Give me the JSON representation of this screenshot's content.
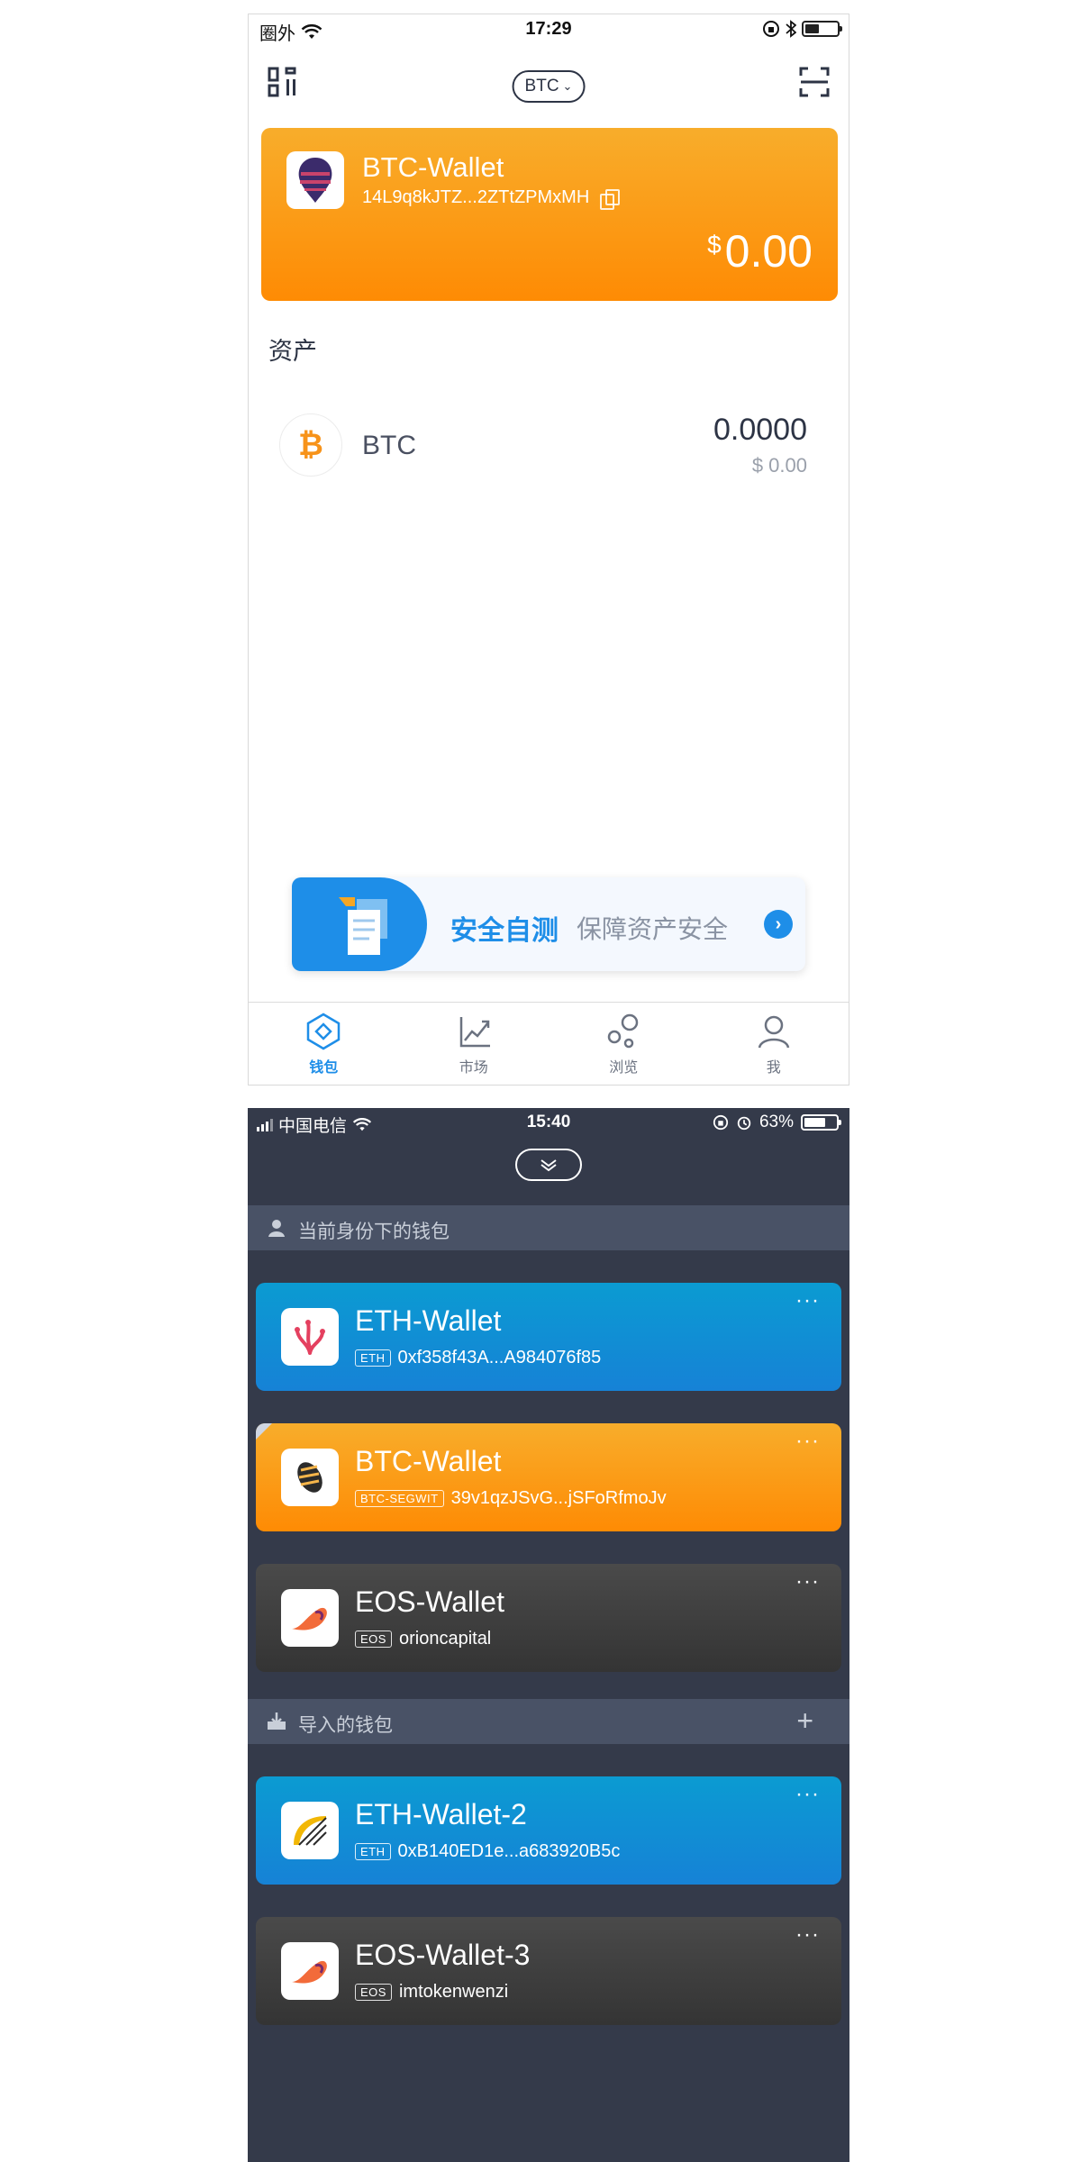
{
  "screen1": {
    "status": {
      "carrier": "圈外",
      "time": "17:29"
    },
    "header": {
      "coin_select": "BTC"
    },
    "wallet": {
      "name": "BTC-Wallet",
      "address": "14L9q8kJTZ...2ZTtZPMxMH",
      "currency_symbol": "$",
      "balance": "0.00"
    },
    "assets": {
      "title": "资产",
      "items": [
        {
          "symbol": "BTC",
          "amount": "0.0000",
          "fiat": "$ 0.00"
        }
      ]
    },
    "banner": {
      "title": "安全自测",
      "subtitle": "保障资产安全"
    },
    "tabs": [
      {
        "label": "钱包",
        "icon": "wallet-icon",
        "active": true
      },
      {
        "label": "市场",
        "icon": "market-chart-icon",
        "active": false
      },
      {
        "label": "浏览",
        "icon": "browse-bubbles-icon",
        "active": false
      },
      {
        "label": "我",
        "icon": "profile-icon",
        "active": false
      }
    ],
    "colors": {
      "accent": "#1e8ee8",
      "btc_orange": "#fe8b04",
      "text": "#2d3445"
    }
  },
  "screen2": {
    "status": {
      "carrier": "中国电信",
      "time": "15:40",
      "battery": "63%"
    },
    "identity_section": {
      "label": "当前身份下的钱包"
    },
    "identity_wallets": [
      {
        "name": "ETH-Wallet",
        "tag": "ETH",
        "address": "0xf358f43A...A984076f85",
        "more": "···"
      },
      {
        "name": "BTC-Wallet",
        "tag": "BTC-SEGWIT",
        "address": "39v1qzJSvG...jSFoRfmoJv",
        "more": "···"
      },
      {
        "name": "EOS-Wallet",
        "tag": "EOS",
        "address": "orioncapital",
        "more": "···"
      }
    ],
    "imported_section": {
      "label": "导入的钱包",
      "add": "+"
    },
    "imported_wallets": [
      {
        "name": "ETH-Wallet-2",
        "tag": "ETH",
        "address": "0xB140ED1e...a683920B5c",
        "more": "···"
      },
      {
        "name": "EOS-Wallet-3",
        "tag": "EOS",
        "address": "imtokenwenzi",
        "more": "···"
      }
    ],
    "colors": {
      "background": "#343a4a",
      "section": "#495266",
      "eth_blue": "#0b9bd2",
      "eos_dark": "#3d3d3d"
    }
  }
}
